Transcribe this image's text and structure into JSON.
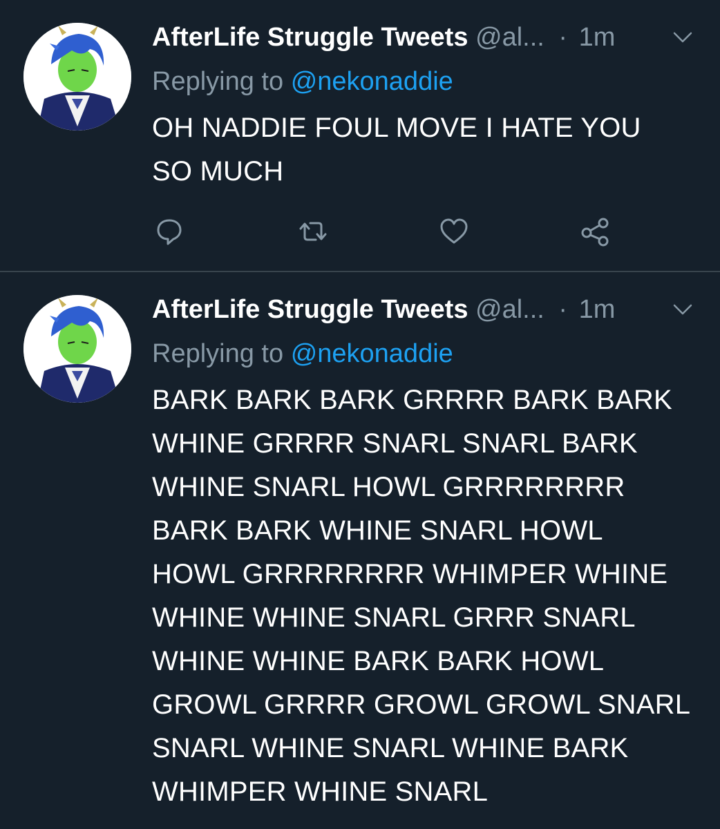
{
  "tweets": [
    {
      "author_name": "AfterLife Struggle Tweets",
      "author_handle": "@al...",
      "separator": "·",
      "time": "1m",
      "reply_prefix": "Replying to",
      "reply_mention": "@nekonaddie",
      "text": "OH NADDIE FOUL MOVE I HATE YOU\nSO MUCH",
      "actions": [
        "reply-icon",
        "retweet-icon",
        "like-icon",
        "share-icon"
      ]
    },
    {
      "author_name": "AfterLife Struggle Tweets",
      "author_handle": "@al...",
      "separator": "·",
      "time": "1m",
      "reply_prefix": "Replying to",
      "reply_mention": "@nekonaddie",
      "text": "BARK BARK BARK GRRRR BARK BARK\nWHINE GRRRR SNARL SNARL BARK\nWHINE SNARL HOWL GRRRRRRRR\nBARK BARK WHINE SNARL HOWL\nHOWL GRRRRRRRR WHIMPER WHINE\nWHINE WHINE SNARL GRRR SNARL\nWHINE WHINE BARK BARK HOWL\nGROWL GRRRR GROWL GROWL SNARL\nSNARL WHINE SNARL WHINE BARK\nWHIMPER WHINE SNARL"
    }
  ],
  "colors": {
    "background": "#15202b",
    "divider": "#38444d",
    "secondary_text": "#8899a6",
    "link": "#1da1f2",
    "primary_text": "#ffffff"
  }
}
